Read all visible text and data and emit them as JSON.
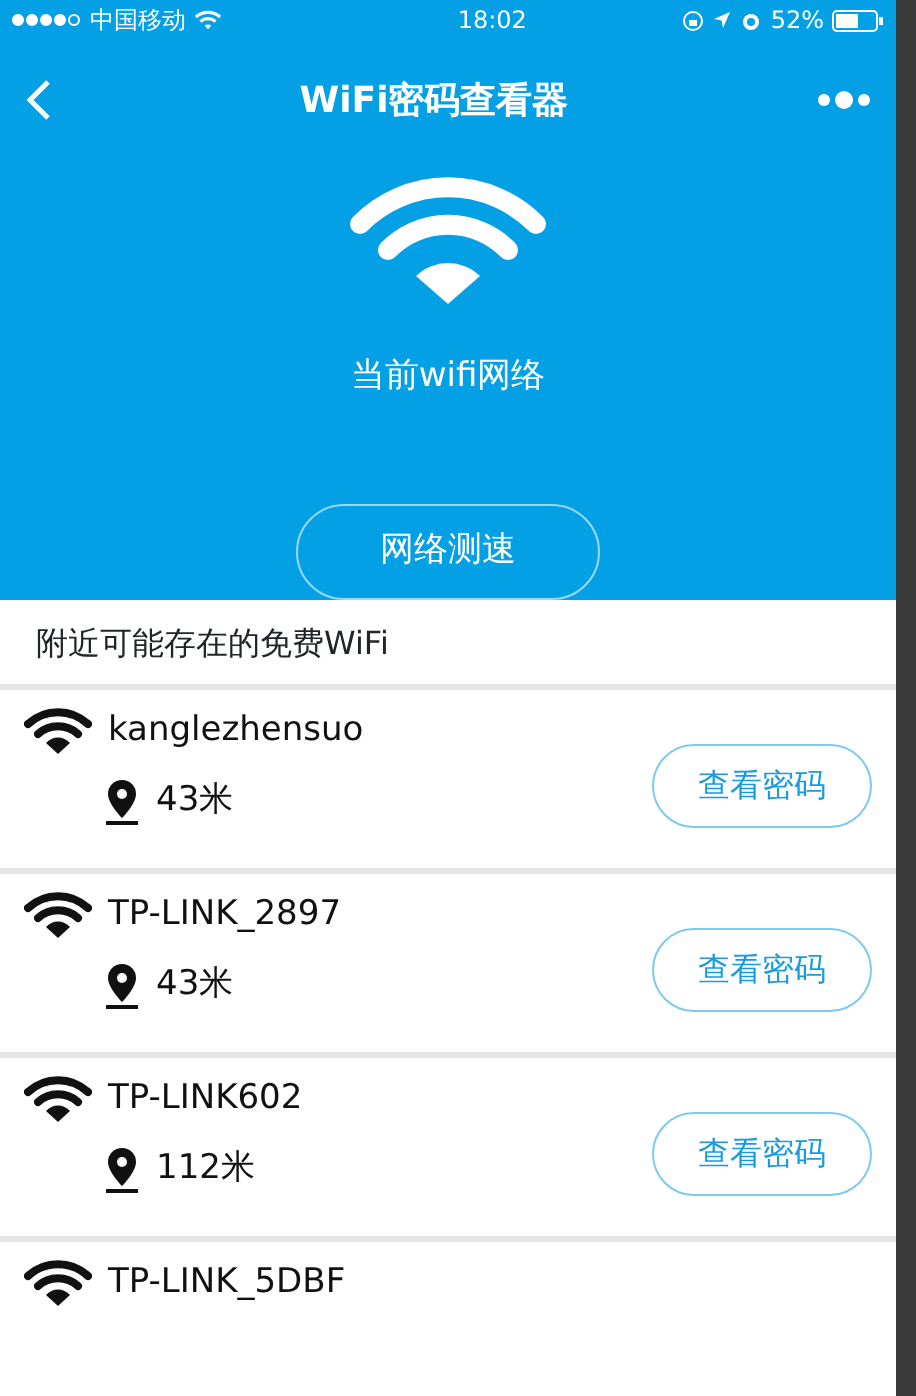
{
  "status_bar": {
    "signal_dots": [
      {
        "filled": true
      },
      {
        "filled": true
      },
      {
        "filled": true
      },
      {
        "filled": true
      },
      {
        "filled": false
      }
    ],
    "carrier": "中国移动",
    "time": "18:02",
    "battery": "52%"
  },
  "nav": {
    "title": "WiFi密码查看器"
  },
  "header": {
    "network_label": "当前wifi网络",
    "speed_button": "网络测速"
  },
  "section_title": "附近可能存在的免费WiFi",
  "networks": [
    {
      "name": "kanglezhensuo",
      "distance": "43米",
      "button": "查看密码"
    },
    {
      "name": "TP-LINK_2897",
      "distance": "43米",
      "button": "查看密码"
    },
    {
      "name": "TP-LINK602",
      "distance": "112米",
      "button": "查看密码"
    },
    {
      "name": "TP-LINK_5DBF"
    }
  ]
}
